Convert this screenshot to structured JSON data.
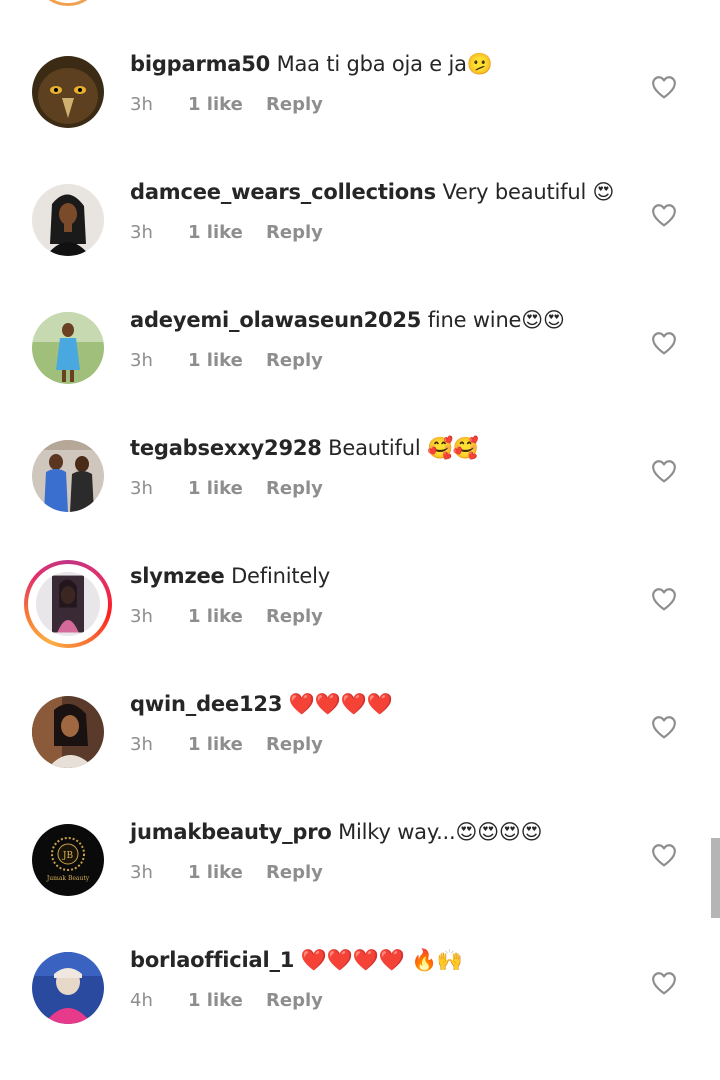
{
  "comments": [
    {
      "username": "bigparma50",
      "text": "Maa ti gba oja e ja🫤",
      "time": "3h",
      "likes": "1 like",
      "reply": "Reply",
      "avatar": "eagle-photo",
      "story": false
    },
    {
      "username": "damcee_wears_collections",
      "text": "Very beautiful 😍",
      "time": "3h",
      "likes": "1 like",
      "reply": "Reply",
      "avatar": "woman-black-dress-photo",
      "story": false
    },
    {
      "username": "adeyemi_olawaseun2025",
      "text": "fine wine😍😍",
      "time": "3h",
      "likes": "1 like",
      "reply": "Reply",
      "avatar": "woman-blue-dress-photo",
      "story": false
    },
    {
      "username": "tegabsexxy2928",
      "text": "Beautiful 🥰🥰",
      "time": "3h",
      "likes": "1 like",
      "reply": "Reply",
      "avatar": "group-photo",
      "story": false
    },
    {
      "username": "slymzee",
      "text": "Definitely",
      "time": "3h",
      "likes": "1 like",
      "reply": "Reply",
      "avatar": "woman-selfie-photo",
      "story": true
    },
    {
      "username": "qwin_dee123",
      "text": "❤️❤️❤️❤️",
      "time": "3h",
      "likes": "1 like",
      "reply": "Reply",
      "avatar": "woman-portrait-photo",
      "story": false
    },
    {
      "username": "jumakbeauty_pro",
      "text": "Milky way...😍😍😍😍",
      "time": "3h",
      "likes": "1 like",
      "reply": "Reply",
      "avatar": "gold-logo",
      "story": false
    },
    {
      "username": "borlaofficial_1",
      "text": "❤️❤️❤️❤️ 🔥🙌",
      "time": "4h",
      "likes": "1 like",
      "reply": "Reply",
      "avatar": "child-pink-photo",
      "story": false
    }
  ],
  "logo_text": "Jumak Beauty",
  "icons": {
    "like": "heart-outline-icon"
  },
  "colors": {
    "username": "#262626",
    "meta": "#8e8e8e",
    "heart": "#8e8e8e",
    "story_ring": "#e1306c"
  }
}
